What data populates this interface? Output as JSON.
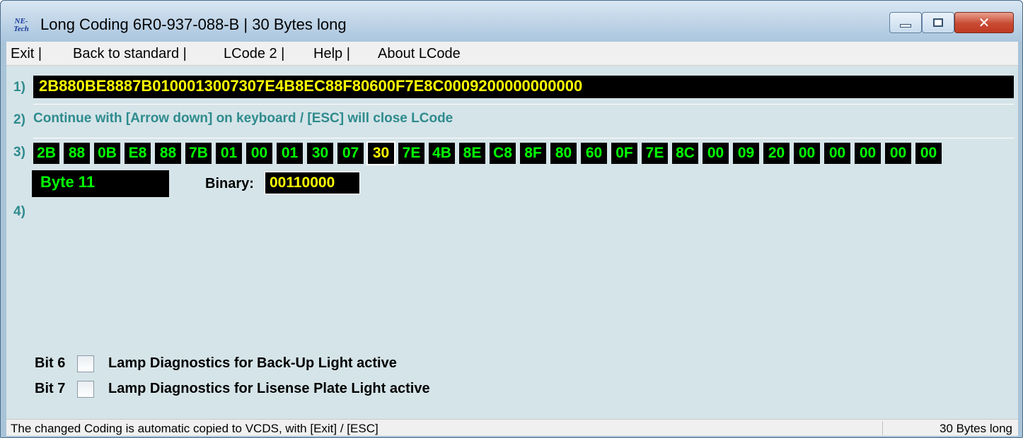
{
  "window": {
    "title": "Long Coding  6R0-937-088-B | 30 Bytes long",
    "icon": "NE-Tech",
    "icon_name": "ne-tech-app-icon"
  },
  "menu": {
    "items": [
      "Exit |",
      "Back to standard |",
      "LCode 2 |",
      "Help |",
      "About LCode"
    ]
  },
  "rows": {
    "r1": "1)",
    "r2": "2)",
    "r3": "3)",
    "r4": "4)"
  },
  "coding_string": "2B880BE8887B0100013007307E4B8EC88F80600F7E8C0009200000000000",
  "instruction": "Continue with [Arrow down] on keyboard / [ESC] will close LCode",
  "bytes": [
    "2B",
    "88",
    "0B",
    "E8",
    "88",
    "7B",
    "01",
    "00",
    "01",
    "30",
    "07",
    "30",
    "7E",
    "4B",
    "8E",
    "C8",
    "8F",
    "80",
    "60",
    "0F",
    "7E",
    "8C",
    "00",
    "09",
    "20",
    "00",
    "00",
    "00",
    "00",
    "00"
  ],
  "selected_byte_index": 11,
  "byte_label": "Byte 11",
  "binary": {
    "label": "Binary:",
    "value": "00110000"
  },
  "bits": [
    {
      "label": "Bit 6",
      "text": "Lamp Diagnostics for Back-Up Light active",
      "checked": false
    },
    {
      "label": "Bit 7",
      "text": "Lamp Diagnostics for Lisense Plate Light active",
      "checked": false
    }
  ],
  "status": {
    "left": "The changed Coding is automatic copied to VCDS, with [Exit] / [ESC]",
    "right": "30 Bytes long"
  },
  "colors": {
    "teal_label": "#2e8b8e",
    "byte_green": "#00ff00",
    "byte_yellow": "#ffff00",
    "client_bg": "#d5e4e8"
  }
}
